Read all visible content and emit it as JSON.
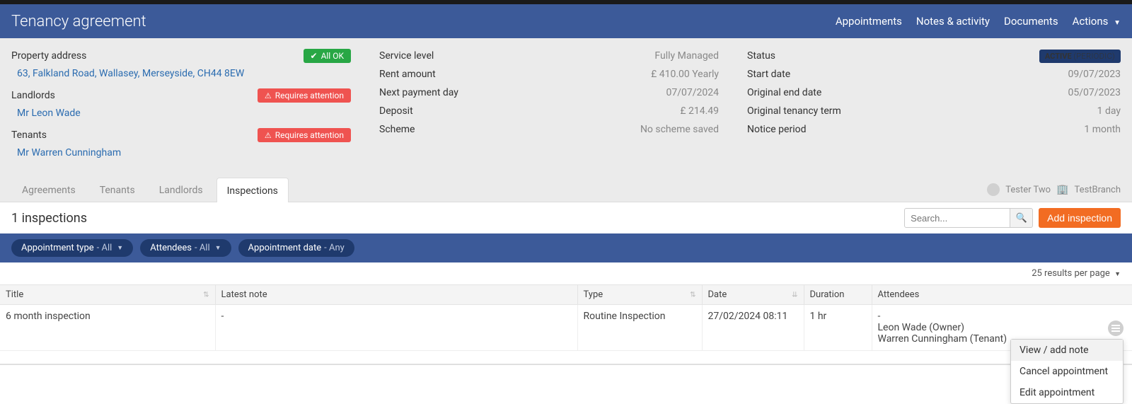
{
  "header": {
    "title": "Tenancy agreement",
    "nav": {
      "appointments": "Appointments",
      "notes": "Notes & activity",
      "documents": "Documents",
      "actions": "Actions"
    }
  },
  "summary": {
    "property_address_label": "Property address",
    "property_address_link": "63, Falkland Road, Wallasey, Merseyside, CH44 8EW",
    "landlords_label": "Landlords",
    "landlord_link": "Mr Leon Wade",
    "tenants_label": "Tenants",
    "tenant_link": "Mr Warren Cunningham",
    "badge_ok": "All OK",
    "badge_attention": "Requires attention",
    "service_level_label": "Service level",
    "service_level_value": "Fully Managed",
    "rent_amount_label": "Rent amount",
    "rent_amount_value": "£ 410.00 Yearly",
    "next_payment_label": "Next payment day",
    "next_payment_value": "07/07/2024",
    "deposit_label": "Deposit",
    "deposit_value": "£ 214.49",
    "scheme_label": "Scheme",
    "scheme_value": "No scheme saved",
    "status_label": "Status",
    "status_badge_main": "ACTIVE",
    "status_badge_sub": "(PERIODIC)",
    "start_date_label": "Start date",
    "start_date_value": "09/07/2023",
    "original_end_label": "Original end date",
    "original_end_value": "05/07/2023",
    "original_term_label": "Original tenancy term",
    "original_term_value": "1 day",
    "notice_label": "Notice period",
    "notice_value": "1 month"
  },
  "tabs": {
    "agreements": "Agreements",
    "tenants": "Tenants",
    "landlords": "Landlords",
    "inspections": "Inspections"
  },
  "user": {
    "name": "Tester Two",
    "branch": "TestBranch"
  },
  "toolbar": {
    "count": "1 inspections",
    "search_placeholder": "Search...",
    "add_button": "Add inspection"
  },
  "filters": {
    "f1_label": "Appointment type",
    "f1_val": "All",
    "f2_label": "Attendees",
    "f2_val": "All",
    "f3_label": "Appointment date",
    "f3_val": "Any"
  },
  "results_per_page": "25 results per page",
  "columns": {
    "title": "Title",
    "latest_note": "Latest note",
    "type": "Type",
    "date": "Date",
    "duration": "Duration",
    "attendees": "Attendees"
  },
  "row": {
    "title": "6 month inspection",
    "latest_note": "-",
    "type": "Routine Inspection",
    "date": "27/02/2024 08:11",
    "duration": "1 hr",
    "attendee_dash": "-",
    "attendee1": "Leon Wade (Owner)",
    "attendee2": "Warren Cunningham (Tenant)"
  },
  "menu": {
    "view_note": "View / add note",
    "cancel": "Cancel appointment",
    "edit": "Edit appointment"
  }
}
